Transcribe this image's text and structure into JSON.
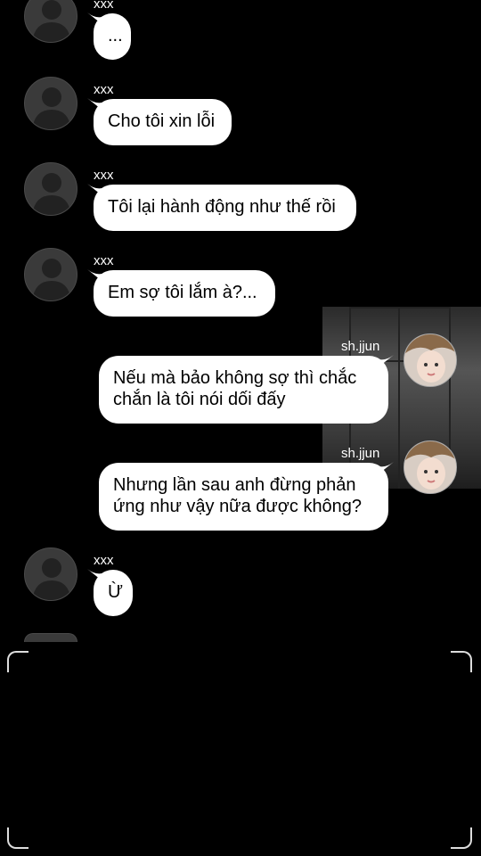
{
  "chat": {
    "messages": [
      {
        "sender": "xxx",
        "text": "..."
      },
      {
        "sender": "xxx",
        "text": "Cho tôi xin lỗi"
      },
      {
        "sender": "xxx",
        "text": "Tôi lại hành động như thế rồi"
      },
      {
        "sender": "xxx",
        "text": "Em sợ tôi lắm à?..."
      },
      {
        "sender": "sh.jjun",
        "text": " Nếu mà bảo không sợ thì chắc chắn là tôi nói dối đấy"
      },
      {
        "sender": "sh.jjun",
        "text": " Nhưng lần sau anh đừng phản ứng như vậy nữa được không?"
      },
      {
        "sender": "xxx",
        "text": "Ừ"
      }
    ]
  },
  "icons": {
    "default_avatar": "person-silhouette-icon",
    "user_avatar": "profile-photo"
  }
}
